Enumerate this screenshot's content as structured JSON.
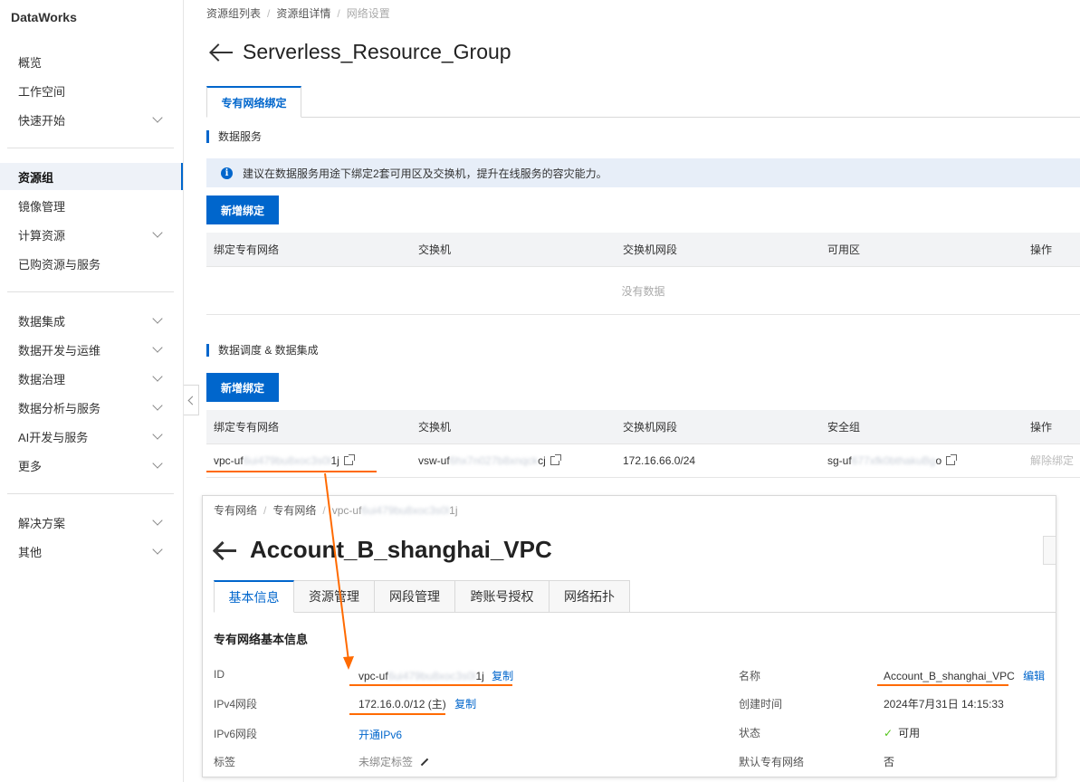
{
  "sidebar": {
    "brand": "DataWorks",
    "items": [
      {
        "label": "概览"
      },
      {
        "label": "工作空间"
      },
      {
        "label": "快速开始"
      },
      {
        "label": "资源组"
      },
      {
        "label": "镜像管理"
      },
      {
        "label": "计算资源"
      },
      {
        "label": "已购资源与服务"
      },
      {
        "label": "数据集成"
      },
      {
        "label": "数据开发与运维"
      },
      {
        "label": "数据治理"
      },
      {
        "label": "数据分析与服务"
      },
      {
        "label": "AI开发与服务"
      },
      {
        "label": "更多"
      },
      {
        "label": "解决方案"
      },
      {
        "label": "其他"
      }
    ]
  },
  "breadcrumb": [
    "资源组列表",
    "资源组详情",
    "网络设置"
  ],
  "page_title": "Serverless_Resource_Group",
  "tab": "专有网络绑定",
  "data_service": {
    "title": "数据服务",
    "banner": "建议在数据服务用途下绑定2套可用区及交换机，提升在线服务的容灾能力。",
    "add_button": "新增绑定",
    "columns": [
      "绑定专有网络",
      "交换机",
      "交换机网段",
      "可用区",
      "操作"
    ],
    "empty_text": "没有数据"
  },
  "scheduling": {
    "title": "数据调度 & 数据集成",
    "add_button": "新增绑定",
    "columns": [
      "绑定专有网络",
      "交换机",
      "交换机网段",
      "安全组",
      "操作"
    ],
    "row": {
      "vpc_prefix": "vpc-uf",
      "vpc_hidden": "6ui479bu8xoc3s0l",
      "vpc_suffix": "1j",
      "vsw_prefix": "vsw-uf",
      "vsw_hidden": "6hx7n027b8xnqck",
      "vsw_suffix": "cj",
      "cidr": "172.16.66.0/24",
      "sg_prefix": "sg-uf",
      "sg_hidden": "677xfk0bthakuBg",
      "sg_suffix": "o",
      "action": "解除绑定"
    }
  },
  "vpc_panel": {
    "breadcrumb": [
      "专有网络",
      "专有网络"
    ],
    "breadcrumb_last_prefix": "vpc-uf",
    "breadcrumb_last_hidden": "6ui479bu8xoc3s0l",
    "breadcrumb_last_suffix": "1j",
    "title": "Account_B_shanghai_VPC",
    "tabs": [
      "基本信息",
      "资源管理",
      "网段管理",
      "跨账号授权",
      "网络拓扑"
    ],
    "section_title": "专有网络基本信息",
    "fields": {
      "id_label": "ID",
      "id_prefix": "vpc-uf",
      "id_hidden": "6ui479bu8xoc3s0l",
      "id_suffix": "1j",
      "copy": "复制",
      "ipv4_label": "IPv4网段",
      "ipv4_value": "172.16.0.0/12 (主)",
      "ipv6_label": "IPv6网段",
      "ipv6_value": "开通IPv6",
      "tag_label": "标签",
      "tag_value": "未绑定标签",
      "name_label": "名称",
      "name_value": "Account_B_shanghai_VPC",
      "edit": "编辑",
      "created_label": "创建时间",
      "created_value": "2024年7月31日 14:15:33",
      "status_label": "状态",
      "status_value": "可用",
      "default_label": "默认专有网络",
      "default_value": "否"
    }
  },
  "colors": {
    "accent": "#0066cc",
    "highlight": "#ff6a00",
    "banner_bg": "#e7eef8",
    "status_ok": "#52c41a"
  }
}
